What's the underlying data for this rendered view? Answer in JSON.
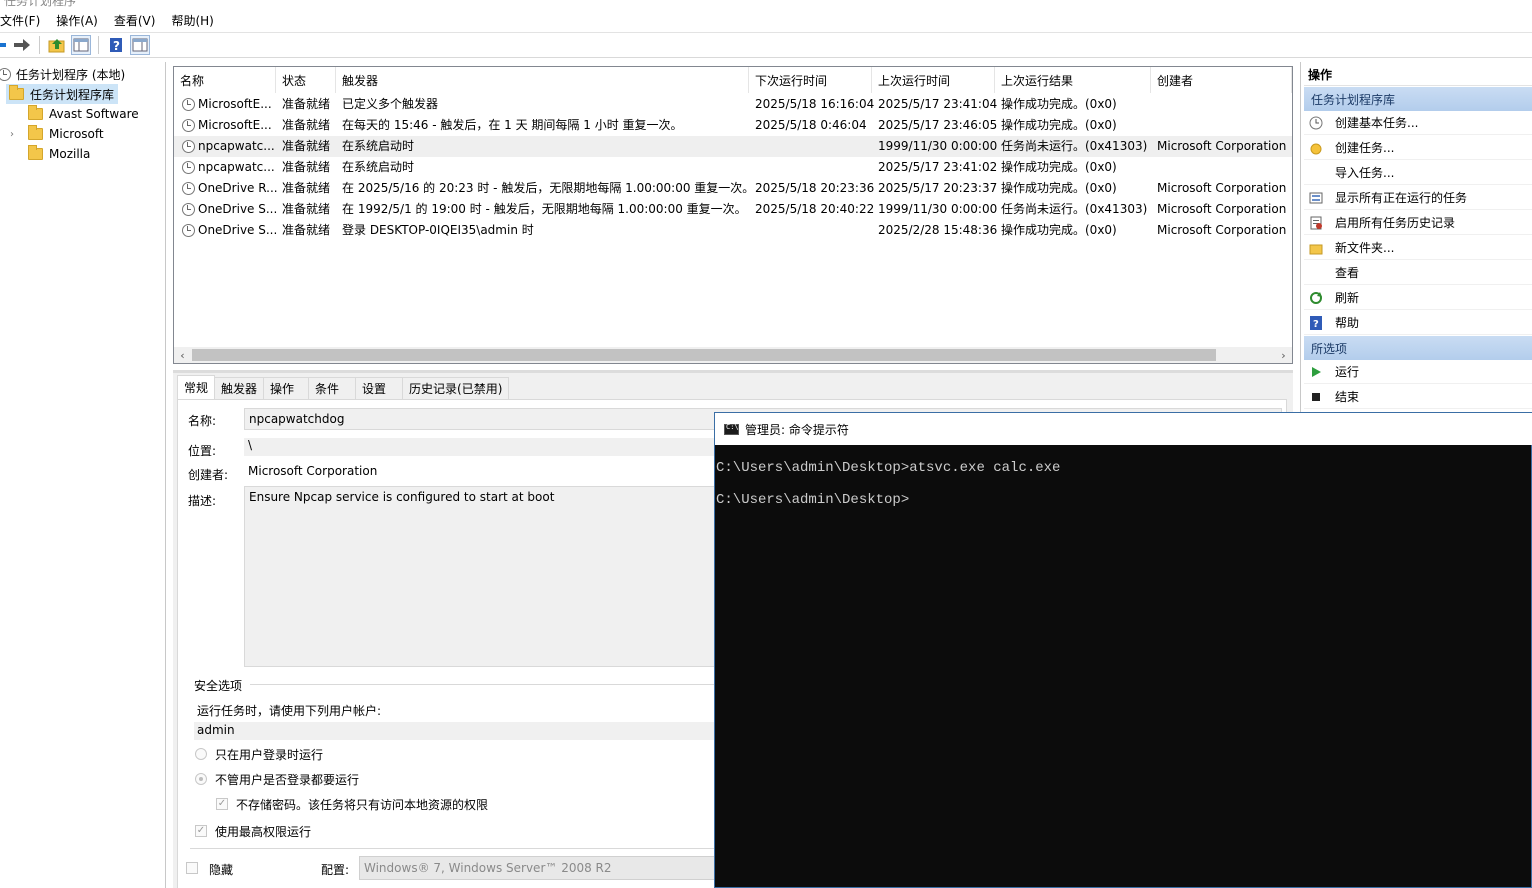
{
  "window": {
    "title_partial": "任务计划程序"
  },
  "menu": [
    "文件(F)",
    "操作(A)",
    "查看(V)",
    "帮助(H)"
  ],
  "toolbar_icons": [
    "back-arrow-icon",
    "forward-arrow-icon",
    "up-folder-icon",
    "show-hide-console-tree-icon",
    "help-icon",
    "show-hide-action-pane-icon"
  ],
  "tree": {
    "root": "任务计划程序 (本地)",
    "library": "任务计划程序库",
    "folders": [
      "Avast Software",
      "Microsoft",
      "Mozilla"
    ]
  },
  "tasklist": {
    "columns": [
      "名称",
      "状态",
      "触发器",
      "下次运行时间",
      "上次运行时间",
      "上次运行结果",
      "创建者"
    ],
    "rows": [
      [
        "MicrosoftE...",
        "准备就绪",
        "已定义多个触发器",
        "2025/5/18 16:16:04",
        "2025/5/17 23:41:04",
        "操作成功完成。(0x0)",
        ""
      ],
      [
        "MicrosoftE...",
        "准备就绪",
        "在每天的 15:46 - 触发后，在 1 天 期间每隔 1 小时 重复一次。",
        "2025/5/18 0:46:04",
        "2025/5/17 23:46:05",
        "操作成功完成。(0x0)",
        ""
      ],
      [
        "npcapwatc...",
        "准备就绪",
        "在系统启动时",
        "",
        "1999/11/30 0:00:00",
        "任务尚未运行。(0x41303)",
        "Microsoft Corporation"
      ],
      [
        "npcapwatc...",
        "准备就绪",
        "在系统启动时",
        "",
        "2025/5/17 23:41:02",
        "操作成功完成。(0x0)",
        ""
      ],
      [
        "OneDrive R...",
        "准备就绪",
        "在 2025/5/16 的 20:23 时 - 触发后，无限期地每隔 1.00:00:00 重复一次。",
        "2025/5/18 20:23:36",
        "2025/5/17 20:23:37",
        "操作成功完成。(0x0)",
        "Microsoft Corporation"
      ],
      [
        "OneDrive S...",
        "准备就绪",
        "在 1992/5/1 的 19:00 时 - 触发后，无限期地每隔 1.00:00:00 重复一次。",
        "2025/5/18 20:40:22",
        "1999/11/30 0:00:00",
        "任务尚未运行。(0x41303)",
        "Microsoft Corporation"
      ],
      [
        "OneDrive S...",
        "准备就绪",
        "登录 DESKTOP-0IQEI35\\admin 时",
        "",
        "2025/2/28 15:48:36",
        "操作成功完成。(0x0)",
        "Microsoft Corporation"
      ]
    ]
  },
  "props": {
    "tabs": [
      "常规",
      "触发器",
      "操作",
      "条件",
      "设置",
      "历史记录(已禁用)"
    ],
    "name_label": "名称:",
    "name_value": "npcapwatchdog",
    "location_label": "位置:",
    "location_value": "\\",
    "author_label": "创建者:",
    "author_value": "Microsoft Corporation",
    "desc_label": "描述:",
    "desc_value": "Ensure Npcap service is configured to start at boot",
    "security_label": "安全选项",
    "run_as_label": "运行任务时，请使用下列用户帐户:",
    "run_as_value": "admin",
    "radio_logged_on": "只在用户登录时运行",
    "radio_whether": "不管用户是否登录都要运行",
    "no_store_pwd": "不存储密码。该任务将只有访问本地资源的权限",
    "highest_priv": "使用最高权限运行",
    "hidden_label": "隐藏",
    "config_label": "配置:",
    "config_value": "Windows® 7, Windows Server™ 2008 R2"
  },
  "actions": {
    "header": "操作",
    "section1": "任务计划程序库",
    "items1": [
      {
        "label": "创建基本任务...",
        "icon": "create-basic-task-icon"
      },
      {
        "label": "创建任务...",
        "icon": "create-task-icon"
      },
      {
        "label": "导入任务...",
        "icon": ""
      },
      {
        "label": "显示所有正在运行的任务",
        "icon": "running-tasks-icon"
      },
      {
        "label": "启用所有任务历史记录",
        "icon": "history-icon"
      },
      {
        "label": "新文件夹...",
        "icon": "new-folder-icon"
      },
      {
        "label": "查看",
        "icon": ""
      },
      {
        "label": "刷新",
        "icon": "refresh-icon"
      },
      {
        "label": "帮助",
        "icon": "help-icon"
      }
    ],
    "section2": "所选项",
    "items2": [
      {
        "label": "运行",
        "icon": "run-icon"
      },
      {
        "label": "结束",
        "icon": "stop-icon"
      }
    ]
  },
  "cmd": {
    "title": "管理员: 命令提示符",
    "lines": [
      "C:\\Users\\admin\\Desktop>atsvc.exe calc.exe",
      "C:\\Users\\admin\\Desktop>"
    ]
  }
}
